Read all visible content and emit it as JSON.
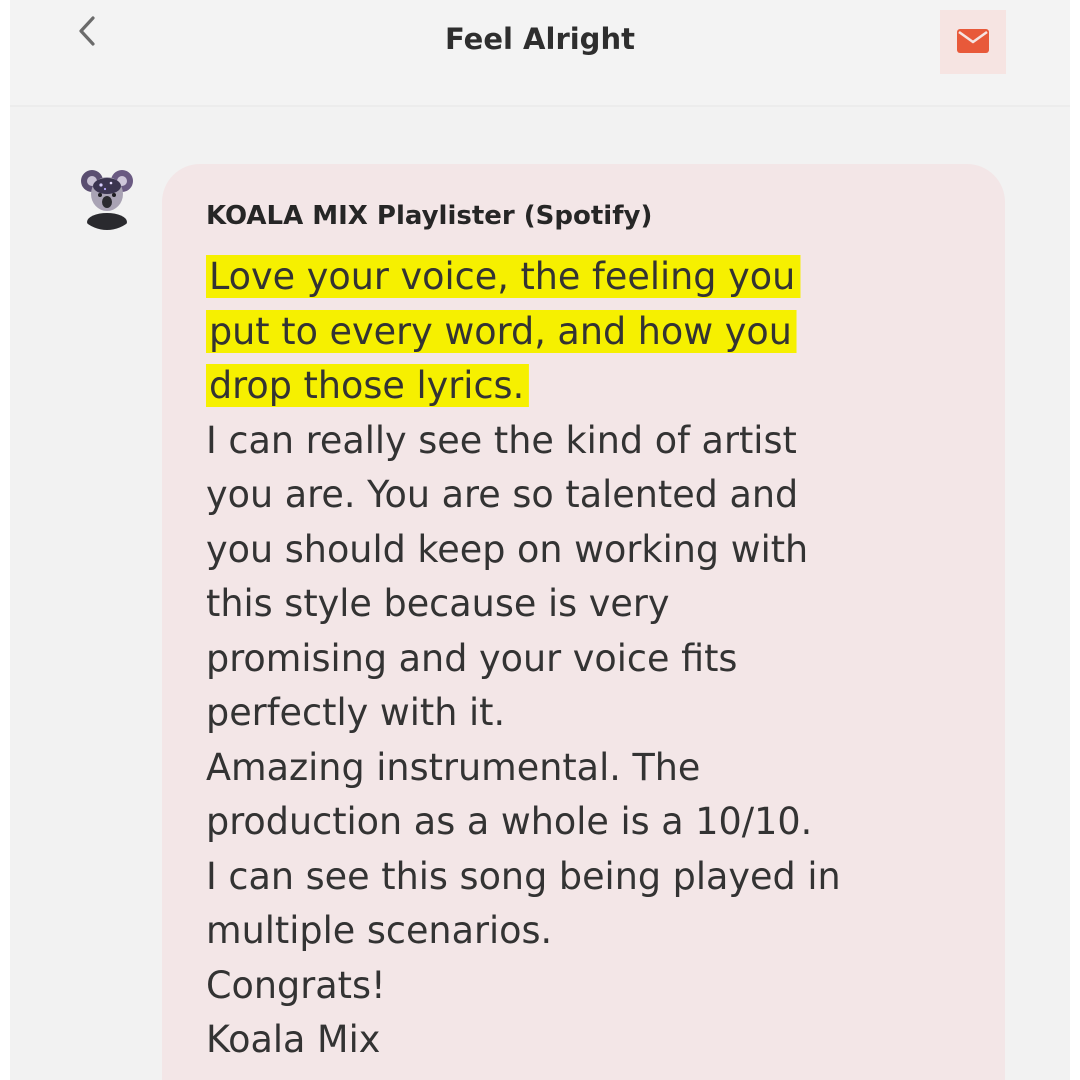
{
  "header": {
    "title": "Feel Alright",
    "back_icon": "chevron-left-icon",
    "mail_icon": "envelope-icon"
  },
  "colors": {
    "accent": "#e8593a",
    "bubble": "#f3e6e7",
    "highlight": "#f6f000"
  },
  "message": {
    "sender": "KOALA MIX Playlister (Spotify)",
    "avatar_icon": "koala-avatar",
    "highlighted_lines": [
      "Love your voice, the feeling you",
      "put to every word, and how you",
      "drop those lyrics."
    ],
    "lines": [
      "I can really see the kind of artist",
      "you are. You are so talented and",
      "you should keep on working with",
      "this style because is very",
      "promising and your voice fits",
      "perfectly with it.",
      "Amazing instrumental. The",
      "production as a whole is a 10/10.",
      "I can see this song being played in",
      "multiple scenarios.",
      "Congrats!",
      "Koala Mix"
    ]
  }
}
